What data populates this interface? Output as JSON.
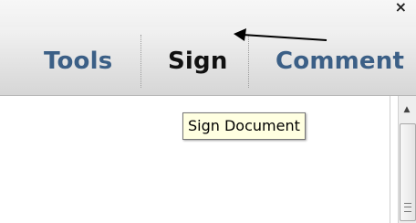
{
  "window": {
    "close_glyph": "×"
  },
  "toolbar": {
    "tabs": [
      {
        "label": "Tools"
      },
      {
        "label": "Sign"
      },
      {
        "label": "Comment"
      }
    ]
  },
  "tooltip": {
    "text": "Sign Document"
  },
  "annotation": {
    "icon": "arrow-left-icon"
  },
  "colors": {
    "tab_text": "#3b5f86",
    "active_tab_text": "#111111",
    "tooltip_bg": "#ffffe1",
    "toolbar_bg": "#dedede"
  }
}
